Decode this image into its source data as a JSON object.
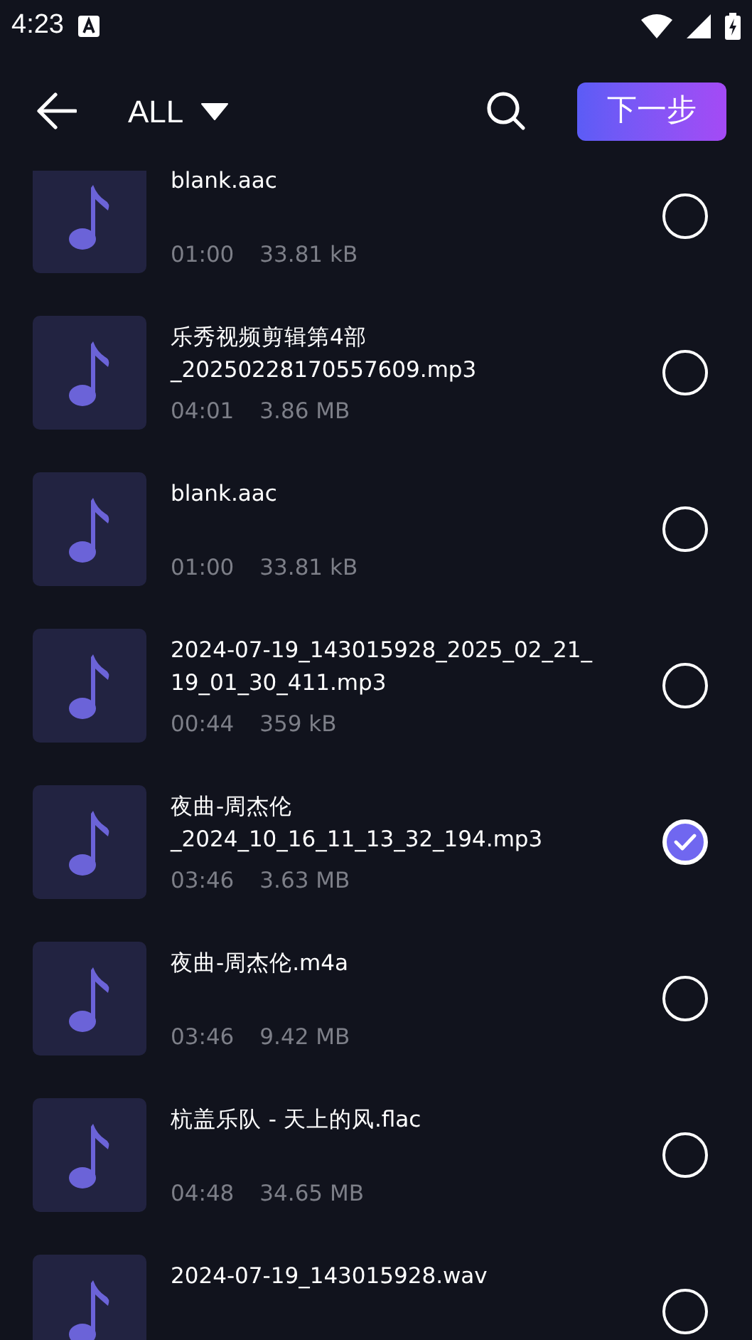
{
  "status_bar": {
    "time": "4:23"
  },
  "header": {
    "filter": "ALL",
    "next_button": "下一步"
  },
  "files": [
    {
      "name": "blank.aac",
      "duration": "01:00",
      "size": "33.81 kB",
      "selected": false
    },
    {
      "name": "乐秀视频剪辑第4部\n_20250228170557609.mp3",
      "duration": "04:01",
      "size": "3.86 MB",
      "selected": false
    },
    {
      "name": "blank.aac",
      "duration": "01:00",
      "size": "33.81 kB",
      "selected": false
    },
    {
      "name": "2024-07-19_143015928_2025_02_21_\n19_01_30_411.mp3",
      "duration": "00:44",
      "size": "359 kB",
      "selected": false
    },
    {
      "name": "夜曲-周杰伦\n_2024_10_16_11_13_32_194.mp3",
      "duration": "03:46",
      "size": "3.63 MB",
      "selected": true
    },
    {
      "name": "夜曲-周杰伦.m4a",
      "duration": "03:46",
      "size": "9.42 MB",
      "selected": false
    },
    {
      "name": "杭盖乐队 - 天上的风.flac",
      "duration": "04:48",
      "size": "34.65 MB",
      "selected": false
    },
    {
      "name": "2024-07-19_143015928.wav",
      "selected": false
    }
  ]
}
